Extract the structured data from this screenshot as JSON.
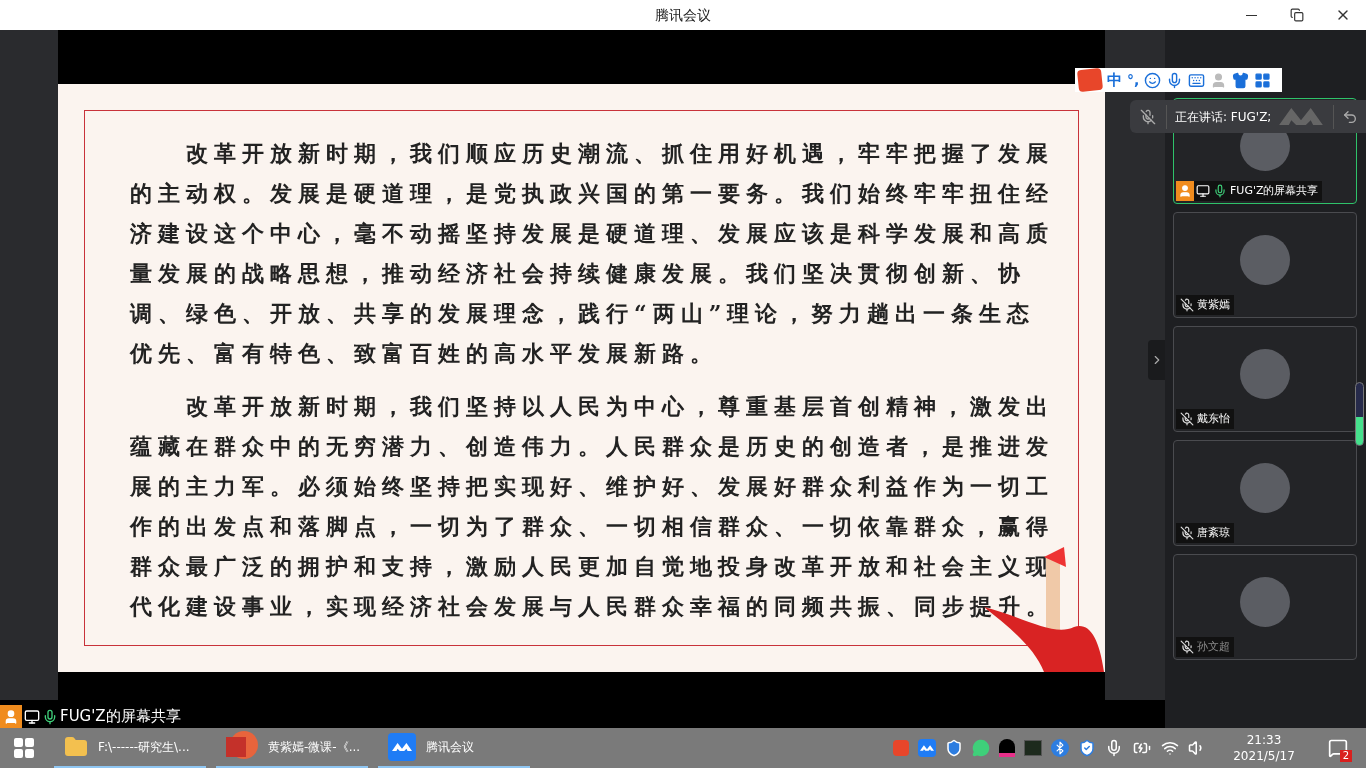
{
  "window": {
    "title": "腾讯会议"
  },
  "slide": {
    "paragraphs": [
      "改革开放新时期，我们顺应历史潮流、抓住用好机遇，牢牢把握了发展的主动权。发展是硬道理，是党执政兴国的第一要务。我们始终牢牢扭住经济建设这个中心，毫不动摇坚持发展是硬道理、发展应该是科学发展和高质量发展的战略思想，推动经济社会持续健康发展。我们坚决贯彻创新、协调、绿色、开放、共享的发展理念，践行“两山”理论，努力趟出一条生态优先、富有特色、致富百姓的高水平发展新路。",
      "改革开放新时期，我们坚持以人民为中心，尊重基层首创精神，激发出蕴藏在群众中的无穷潜力、创造伟力。人民群众是历史的创造者，是推进发展的主力军。必须始终坚持把实现好、维护好、发展好群众利益作为一切工作的出发点和落脚点，一切为了群众、一切相信群众、一切依靠群众，赢得群众最广泛的拥护和支持，激励人民更加自觉地投身改革开放和社会主义现代化建设事业，实现经济社会发展与人民群众幸福的同频共振、同步提升。"
    ]
  },
  "ime_toolbar": {
    "mode": "中",
    "punctuation": "°,"
  },
  "speaking": {
    "label": "正在讲话: FUG'Z;"
  },
  "participants": [
    {
      "name": "FUG'Z的屏幕共享",
      "muted": false,
      "sharing": true,
      "speaking": true,
      "dimmed": false
    },
    {
      "name": "黄紫嫣",
      "muted": true,
      "sharing": false,
      "speaking": false,
      "dimmed": false
    },
    {
      "name": "戴东怡",
      "muted": true,
      "sharing": false,
      "speaking": false,
      "dimmed": false
    },
    {
      "name": "唐紊琼",
      "muted": true,
      "sharing": false,
      "speaking": false,
      "dimmed": false
    },
    {
      "name": "孙文超",
      "muted": true,
      "sharing": false,
      "speaking": false,
      "dimmed": true
    }
  ],
  "share_label": {
    "text": "FUG'Z的屏幕共享"
  },
  "taskbar": {
    "apps": [
      {
        "label": "F:\\------研究生\\...",
        "kind": "folder",
        "running": true
      },
      {
        "label": "黄紫嫣-微课-《...",
        "kind": "slides",
        "running": true
      },
      {
        "label": "腾讯会议",
        "kind": "meeting",
        "running": true
      }
    ],
    "time": "21:33",
    "date": "2021/5/17",
    "notifications": "2"
  }
}
